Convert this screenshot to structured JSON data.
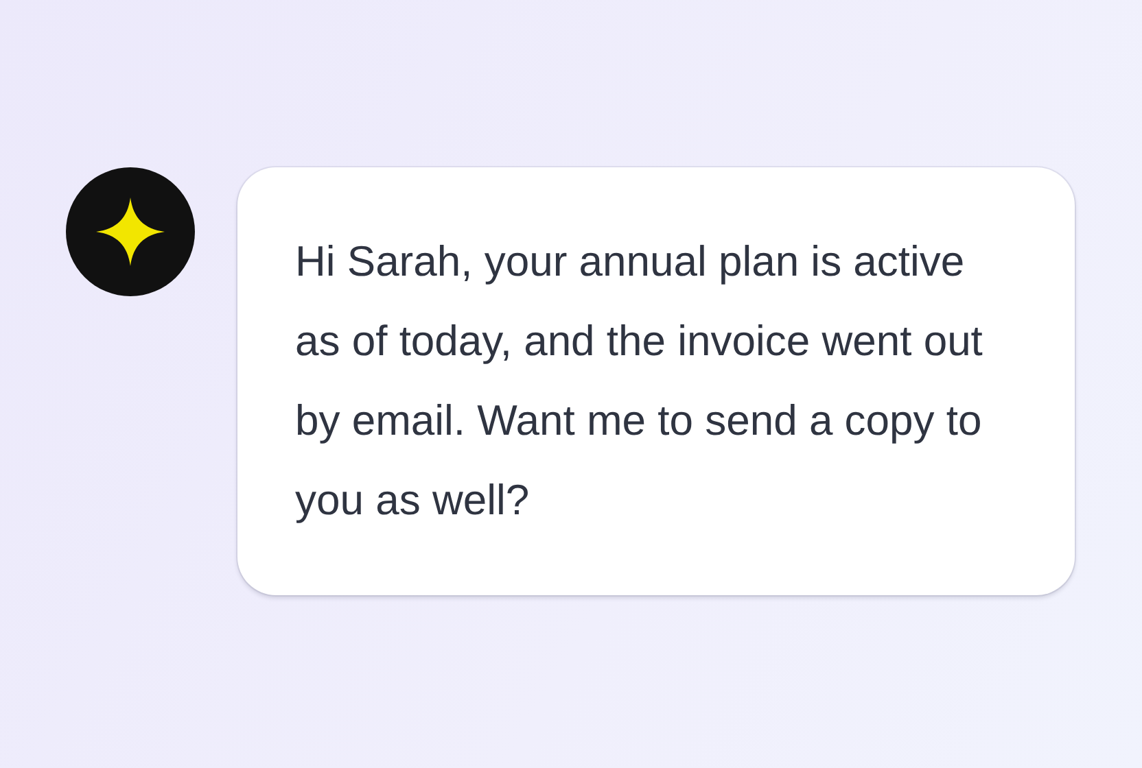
{
  "message": {
    "text": "Hi Sarah, your annual plan is active as of today, and the invoice went out by email. Want me to send a copy to you as well?"
  }
}
